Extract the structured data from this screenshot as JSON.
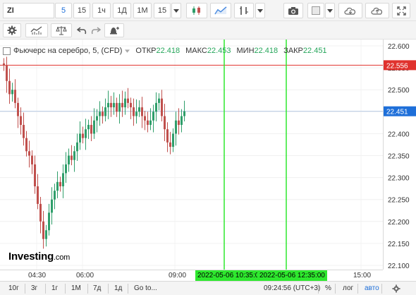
{
  "toolbar": {
    "symbol": "ZI",
    "intervals": [
      "5",
      "15",
      "1ч",
      "1Д",
      "1М",
      "15"
    ],
    "active_interval_index": 0
  },
  "legend": {
    "title": "Фьючерс на серебро, 5, (CFD)",
    "open_label": "ОТКР",
    "open_value": "22.418",
    "high_label": "МАКС",
    "high_value": "22.453",
    "low_label": "МИН",
    "low_value": "22.418",
    "close_label": "ЗАКР",
    "close_value": "22.451"
  },
  "price_axis": {
    "ticks": [
      "22.600",
      "22.550",
      "22.500",
      "22.450",
      "22.400",
      "22.350",
      "22.300",
      "22.250",
      "22.200",
      "22.150",
      "22.100"
    ],
    "red_line_label": "22.556",
    "current_label": "22.451",
    "red_line_color": "#e0322e",
    "current_color": "#1e6fd9"
  },
  "time_axis": {
    "labels": [
      "04:30",
      "06:00",
      "09:00",
      "15:00"
    ],
    "marker_1": "2022-05-06 10:35:00",
    "marker_2": "2022-05-06 12:35:00",
    "marker_color": "#2ee82e"
  },
  "logo": {
    "main": "Investing",
    "suffix": ".com"
  },
  "bottom": {
    "ranges": [
      "10г",
      "3г",
      "1г",
      "1М",
      "7д",
      "1д"
    ],
    "goto": "Go to...",
    "clock": "09:24:56 (UTC+3)",
    "percent": "%",
    "log": "лог",
    "auto": "авто"
  },
  "colors": {
    "up": "#2f9e6a",
    "down": "#c0504d",
    "accent": "#1e6fd9"
  }
}
